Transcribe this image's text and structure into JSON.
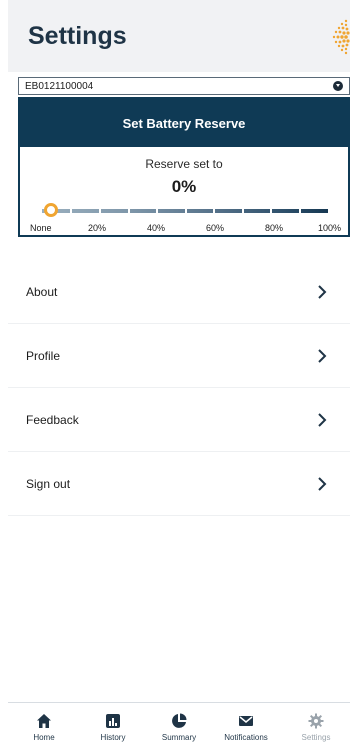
{
  "header": {
    "title": "Settings"
  },
  "device": {
    "selected": "EB0121100004"
  },
  "reserve": {
    "title": "Set Battery Reserve",
    "label": "Reserve set to",
    "value_text": "0%",
    "value": 0,
    "ticks": [
      "None",
      "20%",
      "40%",
      "60%",
      "80%",
      "100%"
    ]
  },
  "menu": {
    "items": [
      {
        "label": "About"
      },
      {
        "label": "Profile"
      },
      {
        "label": "Feedback"
      },
      {
        "label": "Sign out"
      }
    ]
  },
  "nav": {
    "items": [
      {
        "label": "Home",
        "icon": "home-icon"
      },
      {
        "label": "History",
        "icon": "history-chart-icon"
      },
      {
        "label": "Summary",
        "icon": "pie-chart-icon"
      },
      {
        "label": "Notifications",
        "icon": "envelope-icon"
      },
      {
        "label": "Settings",
        "icon": "gear-icon"
      }
    ],
    "active": "Settings"
  },
  "colors": {
    "brand_dark": "#0f3a55",
    "accent": "#f0a531",
    "title": "#1f3446"
  }
}
